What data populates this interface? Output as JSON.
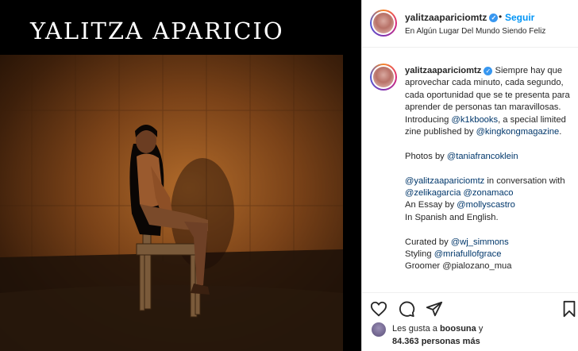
{
  "image": {
    "brand_title": "YALITZA APARICIO"
  },
  "header": {
    "username": "yalitzaapariciomtz",
    "separator": "•",
    "follow_label": "Seguir",
    "location": "En Algún Lugar Del Mundo Siendo Feliz"
  },
  "caption": {
    "username": "yalitzaapariciomtz",
    "text_1": "Siempre hay que aprovechar cada minuto, cada segundo, cada oportunidad que se te presenta para aprender de personas tan maravillosas.",
    "intro_pre": "Introducing ",
    "mention_k1kbooks": "@k1kbooks",
    "intro_mid": ", a special limited zine published by ",
    "mention_kingkong": "@kingkongmagazine",
    "intro_end": ".",
    "photos_pre": "Photos by ",
    "mention_tania": "@taniafrancoklein",
    "mention_yalitza": "@yalitzaapariciomtz",
    "convo_mid": " in conversation with ",
    "mention_zelika": "@zelikagarcia",
    "mention_zonamaco": "@zonamaco",
    "essay_pre": "An Essay by ",
    "mention_molly": "@mollyscastro",
    "languages": "In Spanish and English.",
    "curated_pre": "Curated by ",
    "mention_wj": "@wj_simmons",
    "styling_pre": "Styling ",
    "mention_mria": "@mriafullofgrace",
    "groomer_partial": "Groomer @pialozano_mua"
  },
  "actions": {
    "like_icon": "heart-outline-icon",
    "comment_icon": "speech-bubble-icon",
    "share_icon": "paper-plane-icon",
    "save_icon": "bookmark-icon"
  },
  "likes": {
    "prefix": "Les gusta a ",
    "user": "boosuna",
    "conj": " y",
    "count": "84.363 personas más"
  },
  "colors": {
    "link": "#00376b",
    "follow": "#0095f6",
    "verified": "#3897f0"
  }
}
